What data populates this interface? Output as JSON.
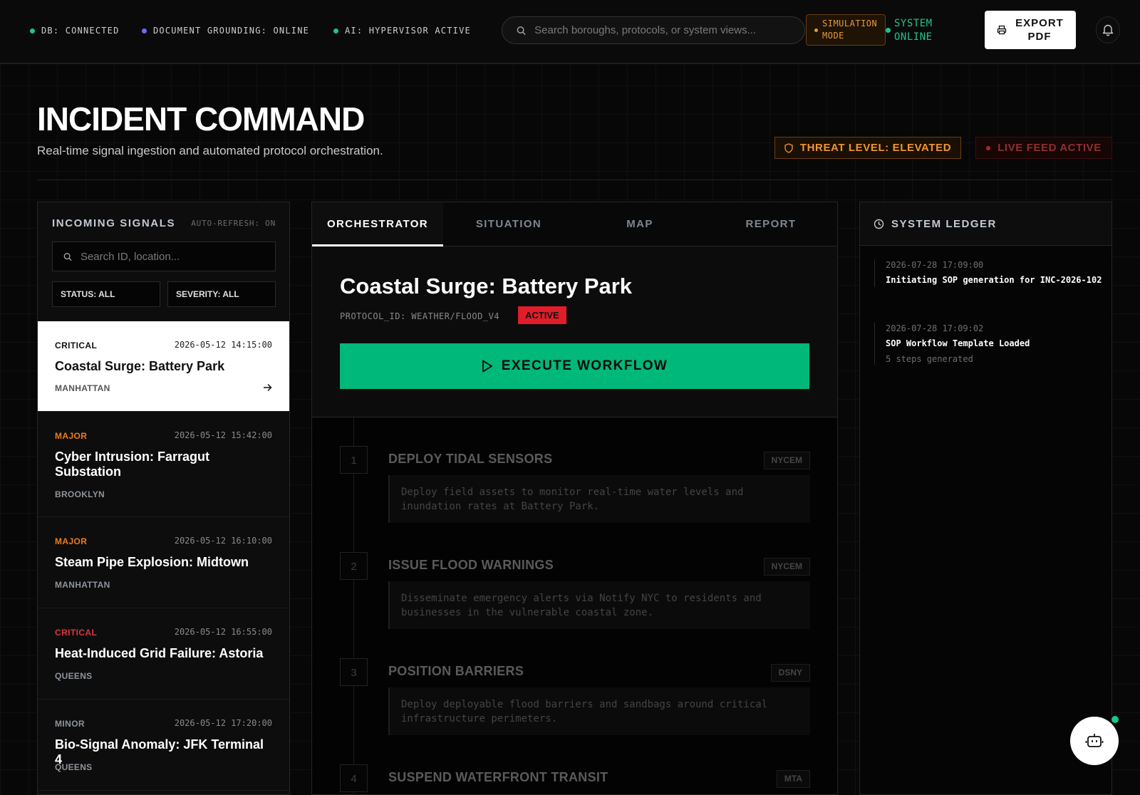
{
  "topbar": {
    "statuses": [
      {
        "label": "DB: CONNECTED",
        "color": "#1fc58a"
      },
      {
        "label": "DOCUMENT GROUNDING: ONLINE",
        "color": "#6b6bff"
      },
      {
        "label": "AI: HYPERVISOR ACTIVE",
        "color": "#1fc58a"
      }
    ],
    "search_placeholder": "Search boroughs, protocols, or system views...",
    "simulation_line1": "SIMULATION",
    "simulation_line2": "MODE",
    "system_line1": "SYSTEM",
    "system_line2": "ONLINE",
    "export_line1": "EXPORT",
    "export_line2": "PDF"
  },
  "header": {
    "title": "INCIDENT COMMAND",
    "subtitle": "Real-time signal ingestion and automated protocol orchestration.",
    "threat_level": "THREAT LEVEL: ELEVATED",
    "live_feed": "LIVE FEED ACTIVE"
  },
  "signals": {
    "title": "INCOMING SIGNALS",
    "auto_refresh": "AUTO-REFRESH: ON",
    "search_placeholder": "Search ID, location...",
    "filter_status": "STATUS: ALL",
    "filter_severity": "SEVERITY: ALL",
    "items": [
      {
        "severity": "CRITICAL",
        "severity_color": "#111111",
        "time": "2026-05-12 14:15:00",
        "title": "Coastal Surge: Battery Park",
        "location": "MANHATTAN"
      },
      {
        "severity": "MAJOR",
        "severity_color": "#f07a1a",
        "time": "2026-05-12 15:42:00",
        "title": "Cyber Intrusion: Farragut Substation",
        "location": "BROOKLYN"
      },
      {
        "severity": "MAJOR",
        "severity_color": "#f07a1a",
        "time": "2026-05-12 16:10:00",
        "title": "Steam Pipe Explosion: Midtown",
        "location": "MANHATTAN"
      },
      {
        "severity": "CRITICAL",
        "severity_color": "#d9363e",
        "time": "2026-05-12 16:55:00",
        "title": "Heat-Induced Grid Failure: Astoria",
        "location": "QUEENS"
      },
      {
        "severity": "MINOR",
        "severity_color": "#8e949c",
        "time": "2026-05-12 17:20:00",
        "title": "Bio-Signal Anomaly: JFK Terminal 4",
        "location": "QUEENS"
      }
    ]
  },
  "tabs": [
    "ORCHESTRATOR",
    "SITUATION",
    "MAP",
    "REPORT"
  ],
  "incident": {
    "title": "Coastal Surge: Battery Park",
    "protocol_id": "PROTOCOL_ID: WEATHER/FLOOD_V4",
    "status": "ACTIVE",
    "execute_label": "EXECUTE WORKFLOW"
  },
  "steps": [
    {
      "num": "1",
      "title": "DEPLOY TIDAL SENSORS",
      "agency": "NYCEM",
      "desc": "Deploy field assets to monitor real-time water levels and inundation rates at Battery Park."
    },
    {
      "num": "2",
      "title": "ISSUE FLOOD WARNINGS",
      "agency": "NYCEM",
      "desc": "Disseminate emergency alerts via Notify NYC to residents and businesses in the vulnerable coastal zone."
    },
    {
      "num": "3",
      "title": "POSITION BARRIERS",
      "agency": "DSNY",
      "desc": "Deploy deployable flood barriers and sandbags around critical infrastructure perimeters."
    },
    {
      "num": "4",
      "title": "SUSPEND WATERFRONT TRANSIT",
      "agency": "MTA",
      "desc": ""
    }
  ],
  "ledger": {
    "title": "SYSTEM LEDGER",
    "entries": [
      {
        "time": "2026-07-28 17:09:00",
        "text": "Initiating SOP generation for INC-2026-102",
        "sub": ""
      },
      {
        "time": "2026-07-28 17:09:02",
        "text": "SOP Workflow Template Loaded",
        "sub": "5 steps generated"
      }
    ]
  }
}
